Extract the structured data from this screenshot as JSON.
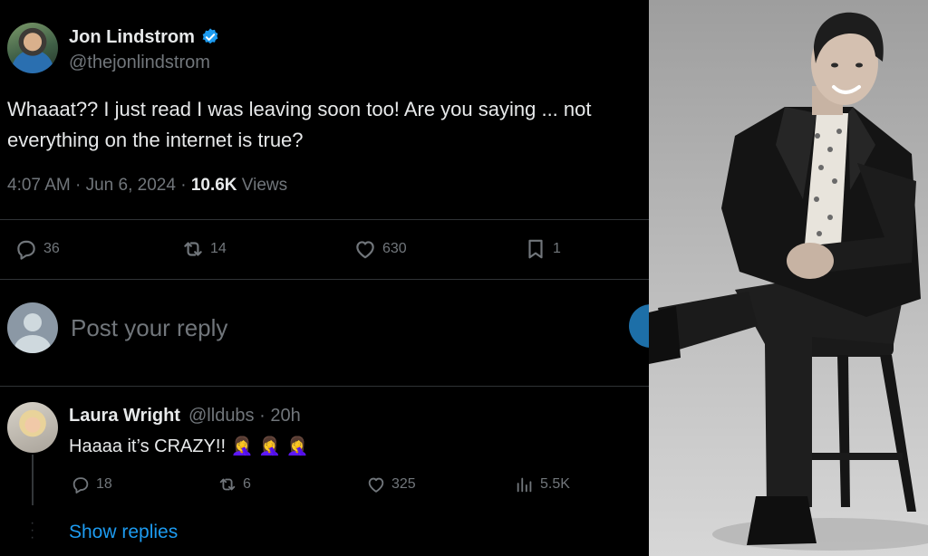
{
  "tweet": {
    "author_name": "Jon Lindstrom",
    "author_handle": "@thejonlindstrom",
    "text": "Whaaat?? I just read I was leaving soon too! Are you saying ... not everything on the internet is true?",
    "time": "4:07 AM",
    "date": "Jun 6, 2024",
    "views_count": "10.6K",
    "views_label": "Views",
    "stats": {
      "replies": "36",
      "reposts": "14",
      "likes": "630",
      "bookmarks": "1"
    }
  },
  "reply_box": {
    "placeholder": "Post your reply"
  },
  "reply": {
    "author_name": "Laura Wright",
    "author_handle": "@lldubs",
    "age": "20h",
    "text": "Haaaa it’s CRAZY!!",
    "emojis": "🤦‍♀️ 🤦‍♀️ 🤦‍♀️",
    "stats": {
      "replies": "18",
      "reposts": "6",
      "likes": "325",
      "views": "5.5K"
    }
  },
  "show_replies": "Show replies",
  "colors": {
    "background": "#000000",
    "text": "#e7e9ea",
    "muted": "#71767b",
    "accent": "#1d9bf0",
    "divider": "#2f3336"
  },
  "icons": [
    "verified-badge-icon",
    "reply-icon",
    "repost-icon",
    "like-icon",
    "bookmark-icon",
    "views-icon",
    "default-avatar-icon"
  ]
}
